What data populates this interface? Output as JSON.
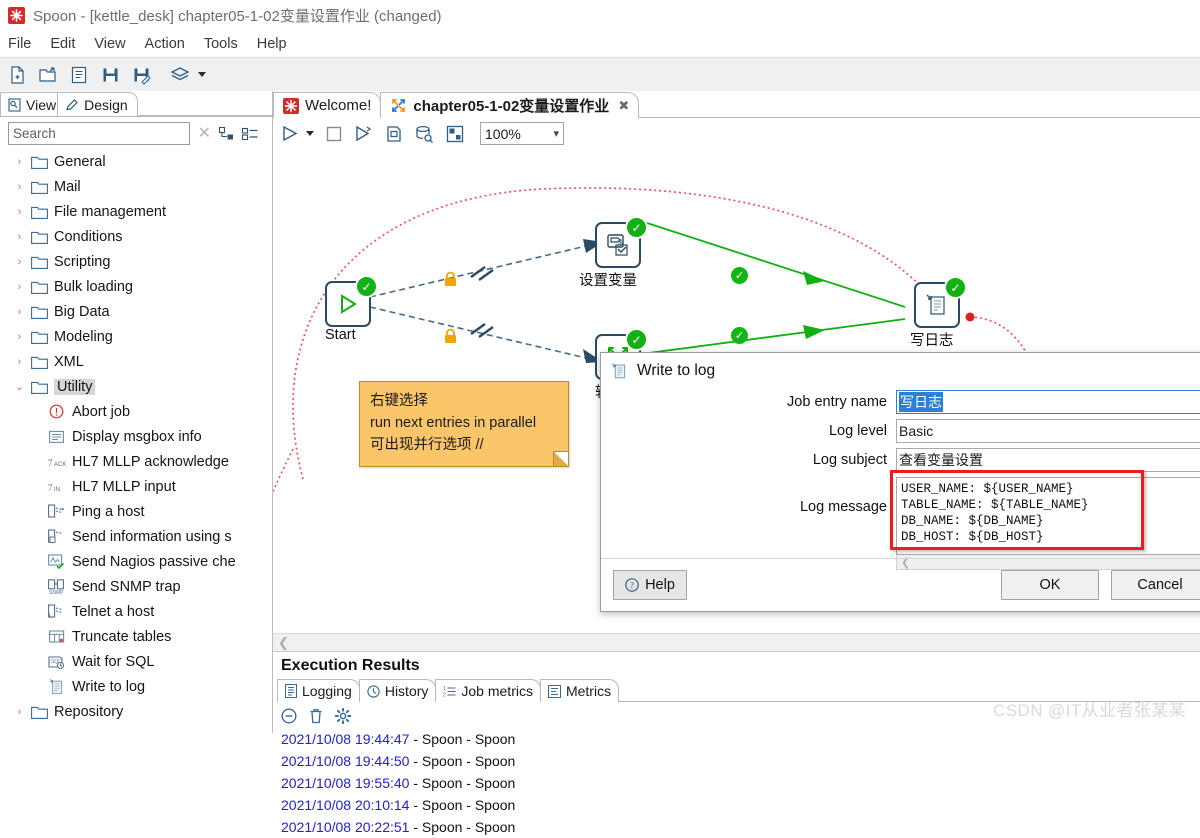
{
  "window": {
    "app_icon": "spoon-logo-icon",
    "title": "Spoon - [kettle_desk] chapter05-1-02变量设置作业 (changed)"
  },
  "menubar": {
    "items": [
      "File",
      "Edit",
      "View",
      "Action",
      "Tools",
      "Help"
    ]
  },
  "toolbar": {
    "buttons": [
      {
        "name": "new-file-icon",
        "tip": "New"
      },
      {
        "name": "open-file-icon",
        "tip": "Open"
      },
      {
        "name": "explore-repository-icon",
        "tip": "Explore"
      },
      {
        "name": "save-icon",
        "tip": "Save"
      },
      {
        "name": "save-as-icon",
        "tip": "Save as"
      },
      {
        "name": "perspective-icon",
        "tip": "Perspectives"
      }
    ]
  },
  "sidebar": {
    "tabs": [
      {
        "label": "View",
        "icon": "view-icon",
        "active": false
      },
      {
        "label": "Design",
        "icon": "pencil-icon",
        "active": true
      }
    ],
    "search": {
      "placeholder": "Search",
      "value": "",
      "clear_icon": "clear-x-icon"
    },
    "tree_buttons": [
      {
        "name": "collapse-all-icon"
      },
      {
        "name": "expand-all-icon"
      }
    ],
    "folders": [
      {
        "label": "General",
        "expanded": false
      },
      {
        "label": "Mail",
        "expanded": false
      },
      {
        "label": "File management",
        "expanded": false
      },
      {
        "label": "Conditions",
        "expanded": false
      },
      {
        "label": "Scripting",
        "expanded": false
      },
      {
        "label": "Bulk loading",
        "expanded": false
      },
      {
        "label": "Big Data",
        "expanded": false
      },
      {
        "label": "Modeling",
        "expanded": false
      },
      {
        "label": "XML",
        "expanded": false
      },
      {
        "label": "Utility",
        "expanded": true,
        "selected": true
      }
    ],
    "utility_items": [
      {
        "label": "Abort job",
        "icon": "abort-icon"
      },
      {
        "label": "Display msgbox info",
        "icon": "msgbox-icon"
      },
      {
        "label": "HL7 MLLP acknowledge",
        "icon": "hl7-ack-icon"
      },
      {
        "label": "HL7 MLLP input",
        "icon": "hl7-in-icon"
      },
      {
        "label": "Ping a host",
        "icon": "ping-icon"
      },
      {
        "label": "Send information using s",
        "icon": "send-info-icon"
      },
      {
        "label": "Send Nagios passive che",
        "icon": "nagios-icon"
      },
      {
        "label": "Send SNMP trap",
        "icon": "snmp-icon"
      },
      {
        "label": "Telnet a host",
        "icon": "telnet-icon"
      },
      {
        "label": "Truncate tables",
        "icon": "truncate-icon"
      },
      {
        "label": "Wait for SQL",
        "icon": "wait-sql-icon"
      },
      {
        "label": "Write to log",
        "icon": "write-to-log-icon"
      }
    ],
    "trailing_folders": [
      {
        "label": "Repository",
        "expanded": false
      }
    ]
  },
  "editor": {
    "tabs": [
      {
        "label": "Welcome!",
        "icon": "welcome-icon",
        "active": false,
        "closable": false
      },
      {
        "label": "chapter05-1-02变量设置作业",
        "icon": "job-icon",
        "active": true,
        "closable": true
      }
    ],
    "toolbar": [
      {
        "name": "run-icon"
      },
      {
        "name": "run-options-caret-icon"
      },
      {
        "name": "stop-icon"
      },
      {
        "name": "preview-icon"
      },
      {
        "name": "debug-icon"
      },
      {
        "name": "sql-icon"
      },
      {
        "name": "arrange-icon"
      }
    ],
    "zoom": {
      "value": "100%",
      "caret_icon": "chevron-down-icon"
    },
    "hscroll_icon": "chevron-left-icon"
  },
  "canvas": {
    "nodes": [
      {
        "id": "start",
        "label": "Start",
        "icon": "start-play-icon",
        "status": "ok"
      },
      {
        "id": "set-variable",
        "label": "设置变量",
        "icon": "set-variable-icon",
        "status": "ok"
      },
      {
        "id": "transform",
        "label": "转换",
        "icon": "transformation-icon",
        "status": "ok"
      },
      {
        "id": "write-log",
        "label": "写日志",
        "icon": "write-to-log-icon",
        "status": "ok"
      }
    ],
    "hop_badges": [
      "lock-icon",
      "lock-icon",
      "parallel-icon",
      "parallel-icon"
    ],
    "note": {
      "lines": [
        "右键选择",
        "run next entries in parallel",
        "可出现并行选项 //"
      ],
      "bg": "#fbc56a"
    }
  },
  "dialog": {
    "icon": "write-to-log-icon",
    "title": "Write to log",
    "fields": [
      {
        "label": "Job entry name",
        "value": "写日志",
        "focused": true,
        "selected": true
      },
      {
        "label": "Log level",
        "value": "Basic",
        "focused": false
      },
      {
        "label": "Log subject",
        "value": "查看变量设置",
        "focused": false
      }
    ],
    "log_message": {
      "label": "Log message",
      "value": "USER_NAME: ${USER_NAME}\nTABLE_NAME: ${TABLE_NAME}\nDB_NAME: ${DB_NAME}\nDB_HOST: ${DB_HOST}",
      "highlight_color": "#ee1c1c"
    },
    "buttons": {
      "help": "Help",
      "ok": "OK",
      "cancel": "Cancel",
      "help_icon": "question-mark-icon"
    }
  },
  "execution_results": {
    "title": "Execution Results",
    "tabs": [
      {
        "label": "Logging",
        "icon": "logging-icon",
        "active": true
      },
      {
        "label": "History",
        "icon": "clock-icon",
        "active": false
      },
      {
        "label": "Job metrics",
        "icon": "job-metrics-icon",
        "active": false
      },
      {
        "label": "Metrics",
        "icon": "metrics-icon",
        "active": false
      }
    ],
    "log_tools": [
      {
        "name": "collapse-log-icon"
      },
      {
        "name": "clear-log-icon"
      },
      {
        "name": "log-settings-icon"
      }
    ],
    "log_lines": [
      {
        "ts": "2021/10/08 19:44:47",
        "rest": " - Spoon - Spoon"
      },
      {
        "ts": "2021/10/08 19:44:50",
        "rest": " - Spoon - Spoon"
      },
      {
        "ts": "2021/10/08 19:55:40",
        "rest": " - Spoon - Spoon"
      },
      {
        "ts": "2021/10/08 20:10:14",
        "rest": " - Spoon - Spoon"
      },
      {
        "ts": "2021/10/08 20:22:51",
        "rest": " - Spoon - Spoon"
      }
    ]
  },
  "watermark": {
    "text": "CSDN @IT从业者张某某",
    "color": "#d9d9d9"
  },
  "colors": {
    "accent_blue": "#2b7fd4",
    "ok_green": "#13b113",
    "annotation_red": "#ee1c1c",
    "note_bg": "#fbc56a",
    "hop_green": "#0db70d",
    "lock_orange": "#f0a500"
  }
}
